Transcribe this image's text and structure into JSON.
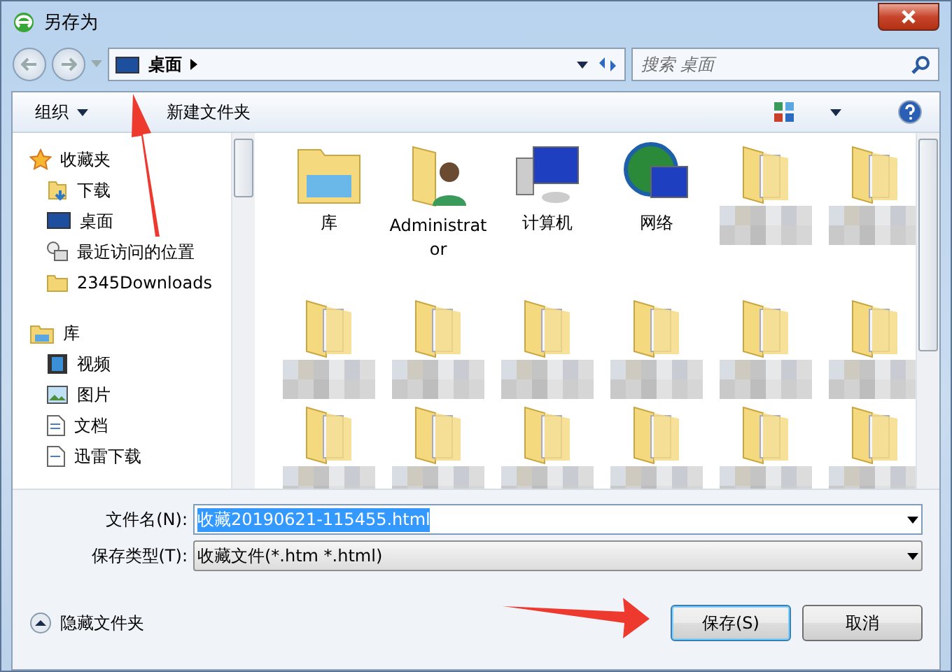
{
  "window": {
    "title": "另存为"
  },
  "address": {
    "location": "桌面",
    "search_placeholder": "搜索 桌面"
  },
  "toolbar": {
    "organize": "组织",
    "new_folder": "新建文件夹"
  },
  "sidebar": {
    "groups": [
      {
        "label": "收藏夹",
        "kind": "favorites",
        "children": [
          {
            "label": "下载",
            "kind": "download"
          },
          {
            "label": "桌面",
            "kind": "desktop"
          },
          {
            "label": "最近访问的位置",
            "kind": "recent"
          },
          {
            "label": "2345Downloads",
            "kind": "folder"
          }
        ]
      },
      {
        "label": "库",
        "kind": "library",
        "children": [
          {
            "label": "视频",
            "kind": "video"
          },
          {
            "label": "图片",
            "kind": "picture"
          },
          {
            "label": "文档",
            "kind": "document"
          },
          {
            "label": "迅雷下载",
            "kind": "download-doc"
          }
        ]
      }
    ]
  },
  "files": [
    {
      "kind": "library",
      "label": "库"
    },
    {
      "kind": "user",
      "label": "Administrator"
    },
    {
      "kind": "computer",
      "label": "计算机"
    },
    {
      "kind": "network",
      "label": "网络"
    },
    {
      "kind": "folder"
    },
    {
      "kind": "folder"
    },
    {
      "kind": "folder"
    },
    {
      "kind": "folder"
    },
    {
      "kind": "folder"
    },
    {
      "kind": "folder"
    },
    {
      "kind": "folder"
    },
    {
      "kind": "folder"
    },
    {
      "kind": "folder"
    },
    {
      "kind": "folder"
    },
    {
      "kind": "folder"
    },
    {
      "kind": "folder"
    },
    {
      "kind": "folder"
    },
    {
      "kind": "folder"
    }
  ],
  "form": {
    "filename_label": "文件名(N):",
    "filename": "收藏20190621-115455.html",
    "type_label": "保存类型(T):",
    "type": "收藏文件(*.htm *.html)"
  },
  "footer": {
    "hide_folders": "隐藏文件夹",
    "save": "保存(S)",
    "cancel": "取消"
  }
}
